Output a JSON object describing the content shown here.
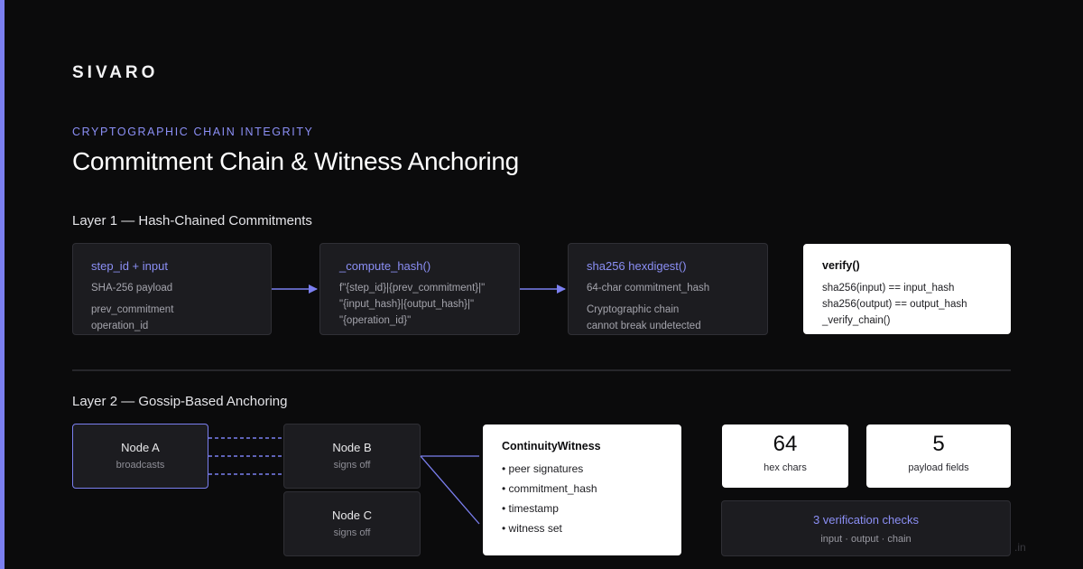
{
  "brand": "SIVARO",
  "eyebrow": "CRYPTOGRAPHIC CHAIN INTEGRITY",
  "title": "Commitment Chain & Witness Anchoring",
  "layer1": {
    "heading": "Layer 1 — Hash-Chained Commitments",
    "boxes": [
      {
        "head": "step_id + input",
        "lines": [
          "SHA-256 payload",
          "prev_commitment",
          "operation_id"
        ]
      },
      {
        "head": "_compute_hash()",
        "lines": [
          "f\"{step_id}|{prev_commitment}|\"",
          "\"{input_hash}|{output_hash}|\"",
          "\"{operation_id}\""
        ]
      },
      {
        "head": "sha256 hexdigest()",
        "lines": [
          "64-char commitment_hash",
          "Cryptographic chain",
          "cannot break undetected"
        ]
      },
      {
        "head": "verify()",
        "lines": [
          "sha256(input) == input_hash",
          "sha256(output) == output_hash",
          "_verify_chain()"
        ]
      }
    ]
  },
  "layer2": {
    "heading": "Layer 2 — Gossip-Based Anchoring",
    "nodes": [
      {
        "name": "Node A",
        "sub": "broadcasts"
      },
      {
        "name": "Node B",
        "sub": "signs off"
      },
      {
        "name": "Node C",
        "sub": "signs off"
      }
    ],
    "witness": {
      "title": "ContinuityWitness",
      "items": [
        "• peer signatures",
        "• commitment_hash",
        "• timestamp",
        "• witness set"
      ]
    },
    "stats": [
      {
        "value": "64",
        "label": "hex chars"
      },
      {
        "value": "5",
        "label": "payload fields"
      }
    ],
    "checks": {
      "title": "3 verification checks",
      "sub": "input · output · chain"
    }
  },
  "watermark": ".in",
  "colors": {
    "accent": "#7b7ff0",
    "background": "#0b0b0c",
    "card": "#1c1c20"
  }
}
